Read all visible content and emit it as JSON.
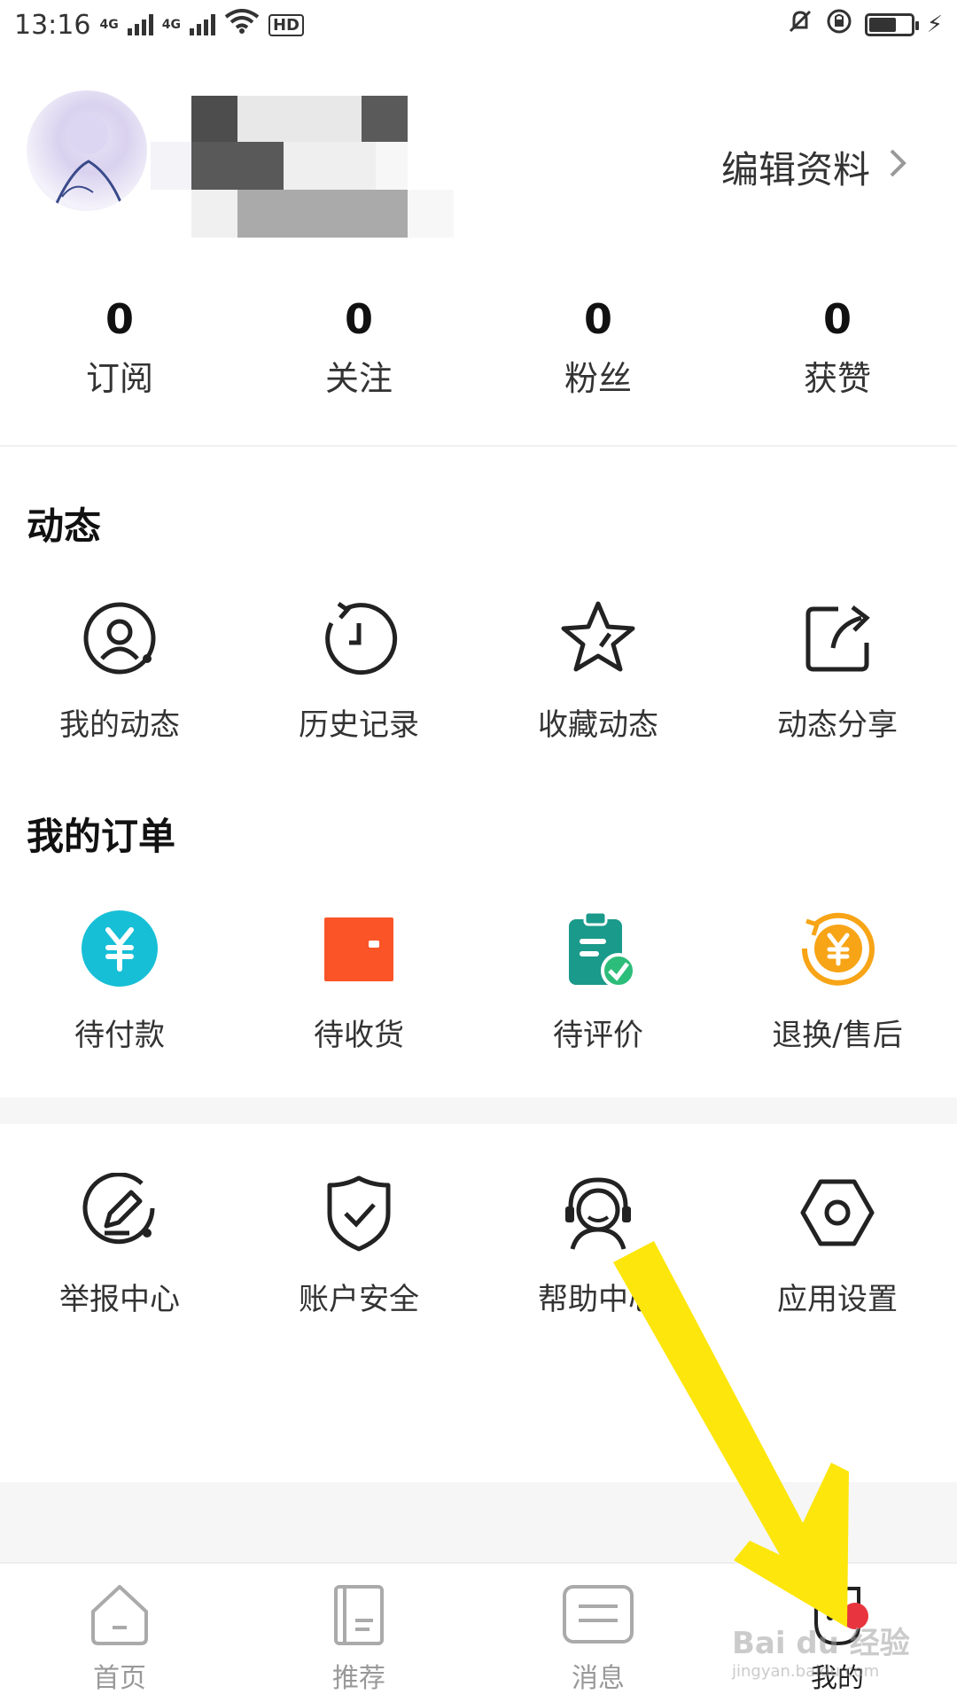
{
  "status_bar": {
    "time": "13:16",
    "network_1": "4G",
    "network_2": "4G",
    "hd": "HD"
  },
  "profile": {
    "edit_label": "编辑资料"
  },
  "stats": [
    {
      "value": "0",
      "label": "订阅"
    },
    {
      "value": "0",
      "label": "关注"
    },
    {
      "value": "0",
      "label": "粉丝"
    },
    {
      "value": "0",
      "label": "获赞"
    }
  ],
  "dynamics": {
    "title": "动态",
    "items": [
      {
        "label": "我的动态",
        "icon": "my-activity-icon"
      },
      {
        "label": "历史记录",
        "icon": "history-icon"
      },
      {
        "label": "收藏动态",
        "icon": "star-icon"
      },
      {
        "label": "动态分享",
        "icon": "share-icon"
      }
    ]
  },
  "orders": {
    "title": "我的订单",
    "items": [
      {
        "label": "待付款",
        "icon": "yen-circle-icon",
        "color": "#16bfd6"
      },
      {
        "label": "待收货",
        "icon": "wallet-icon",
        "color": "#fa5427"
      },
      {
        "label": "待评价",
        "icon": "clipboard-check-icon",
        "color": "#1a9a8a"
      },
      {
        "label": "退换/售后",
        "icon": "refund-icon",
        "color": "#f7a416"
      }
    ]
  },
  "services": {
    "items": [
      {
        "label": "举报中心",
        "icon": "report-pencil-icon"
      },
      {
        "label": "账户安全",
        "icon": "shield-check-icon"
      },
      {
        "label": "帮助中心",
        "icon": "headset-icon"
      },
      {
        "label": "应用设置",
        "icon": "settings-hexagon-icon"
      }
    ]
  },
  "bottom_nav": [
    {
      "label": "首页",
      "icon": "home-icon"
    },
    {
      "label": "推荐",
      "icon": "book-icon"
    },
    {
      "label": "消息",
      "icon": "message-icon"
    },
    {
      "label": "我的",
      "icon": "profile-icon"
    }
  ],
  "watermark": {
    "brand": "Bai du 经验",
    "url": "jingyan.baidu.com"
  }
}
